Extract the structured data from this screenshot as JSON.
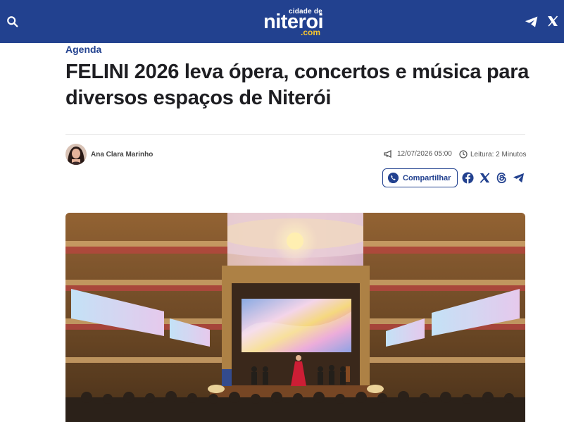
{
  "header": {
    "logo_top": "cidade de",
    "logo_main": "niteroi",
    "logo_domain": ".com",
    "icons": [
      "search-icon",
      "telegram-icon",
      "x-icon"
    ],
    "background": "#22418f",
    "accent": "#f7c62f"
  },
  "article": {
    "category": "Agenda",
    "title": "FELINI 2026 leva ópera, concertos e música para diversos espaços de Niterói",
    "author": "Ana Clara Marinho",
    "date": "12/07/2026 05:00",
    "reading_time": "Leitura: 2 Minutos",
    "share_label": "Compartilhar",
    "share_icons": [
      "whatsapp-icon",
      "facebook-icon",
      "x-icon",
      "threads-icon",
      "telegram-icon"
    ]
  }
}
